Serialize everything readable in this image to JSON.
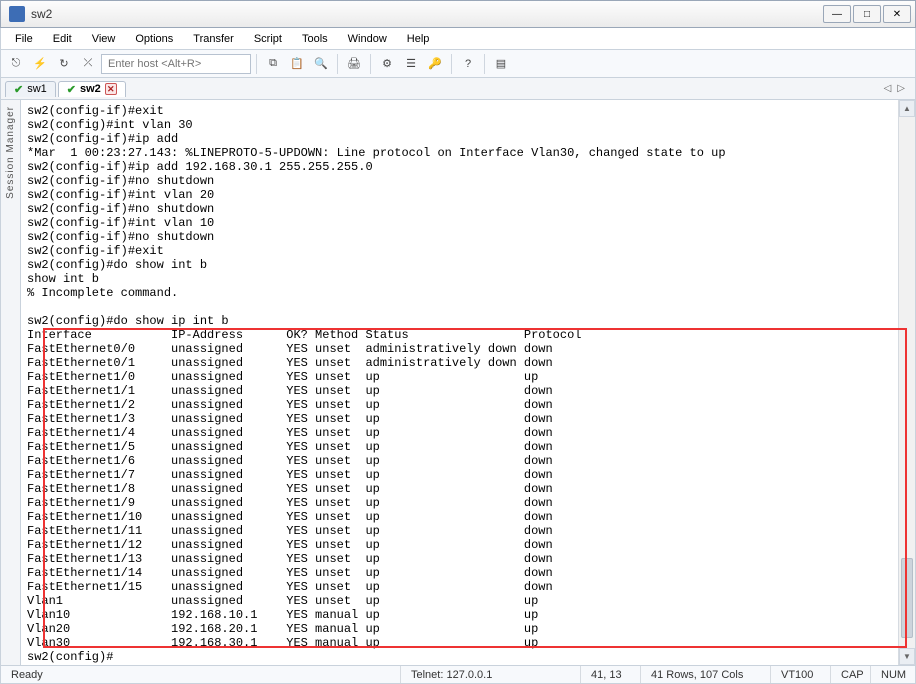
{
  "window": {
    "title": "sw2"
  },
  "menu": {
    "items": [
      "File",
      "Edit",
      "View",
      "Options",
      "Transfer",
      "Script",
      "Tools",
      "Window",
      "Help"
    ]
  },
  "toolbar": {
    "host_placeholder": "Enter host <Alt+R>"
  },
  "tabs": [
    {
      "label": "sw1",
      "active": false
    },
    {
      "label": "sw2",
      "active": true
    }
  ],
  "sidepanel": {
    "label": "Session Manager"
  },
  "terminal": {
    "pre_lines": [
      "sw2(config-if)#exit",
      "sw2(config)#int vlan 30",
      "sw2(config-if)#ip add",
      "*Mar  1 00:23:27.143: %LINEPROTO-5-UPDOWN: Line protocol on Interface Vlan30, changed state to up",
      "sw2(config-if)#ip add 192.168.30.1 255.255.255.0",
      "sw2(config-if)#no shutdown",
      "sw2(config-if)#int vlan 20",
      "sw2(config-if)#no shutdown",
      "sw2(config-if)#int vlan 10",
      "sw2(config-if)#no shutdown",
      "sw2(config-if)#exit",
      "sw2(config)#do show int b",
      "show int b",
      "% Incomplete command.",
      ""
    ],
    "command_line": "sw2(config)#do show ip int b",
    "table": {
      "header": [
        "Interface",
        "IP-Address",
        "OK?",
        "Method",
        "Status",
        "Protocol"
      ],
      "rows": [
        [
          "FastEthernet0/0",
          "unassigned",
          "YES",
          "unset",
          "administratively down",
          "down"
        ],
        [
          "FastEthernet0/1",
          "unassigned",
          "YES",
          "unset",
          "administratively down",
          "down"
        ],
        [
          "FastEthernet1/0",
          "unassigned",
          "YES",
          "unset",
          "up",
          "up"
        ],
        [
          "FastEthernet1/1",
          "unassigned",
          "YES",
          "unset",
          "up",
          "down"
        ],
        [
          "FastEthernet1/2",
          "unassigned",
          "YES",
          "unset",
          "up",
          "down"
        ],
        [
          "FastEthernet1/3",
          "unassigned",
          "YES",
          "unset",
          "up",
          "down"
        ],
        [
          "FastEthernet1/4",
          "unassigned",
          "YES",
          "unset",
          "up",
          "down"
        ],
        [
          "FastEthernet1/5",
          "unassigned",
          "YES",
          "unset",
          "up",
          "down"
        ],
        [
          "FastEthernet1/6",
          "unassigned",
          "YES",
          "unset",
          "up",
          "down"
        ],
        [
          "FastEthernet1/7",
          "unassigned",
          "YES",
          "unset",
          "up",
          "down"
        ],
        [
          "FastEthernet1/8",
          "unassigned",
          "YES",
          "unset",
          "up",
          "down"
        ],
        [
          "FastEthernet1/9",
          "unassigned",
          "YES",
          "unset",
          "up",
          "down"
        ],
        [
          "FastEthernet1/10",
          "unassigned",
          "YES",
          "unset",
          "up",
          "down"
        ],
        [
          "FastEthernet1/11",
          "unassigned",
          "YES",
          "unset",
          "up",
          "down"
        ],
        [
          "FastEthernet1/12",
          "unassigned",
          "YES",
          "unset",
          "up",
          "down"
        ],
        [
          "FastEthernet1/13",
          "unassigned",
          "YES",
          "unset",
          "up",
          "down"
        ],
        [
          "FastEthernet1/14",
          "unassigned",
          "YES",
          "unset",
          "up",
          "down"
        ],
        [
          "FastEthernet1/15",
          "unassigned",
          "YES",
          "unset",
          "up",
          "down"
        ],
        [
          "Vlan1",
          "unassigned",
          "YES",
          "unset",
          "up",
          "up"
        ],
        [
          "Vlan10",
          "192.168.10.1",
          "YES",
          "manual",
          "up",
          "up"
        ],
        [
          "Vlan20",
          "192.168.20.1",
          "YES",
          "manual",
          "up",
          "up"
        ],
        [
          "Vlan30",
          "192.168.30.1",
          "YES",
          "manual",
          "up",
          "up"
        ]
      ]
    },
    "post_lines": [
      "sw2(config)#",
      "sw2(config)#"
    ]
  },
  "status": {
    "ready": "Ready",
    "conn": "Telnet: 127.0.0.1",
    "cursor": "41,  13",
    "size": "41 Rows, 107 Cols",
    "emu": "VT100",
    "cap": "CAP",
    "num": "NUM"
  }
}
